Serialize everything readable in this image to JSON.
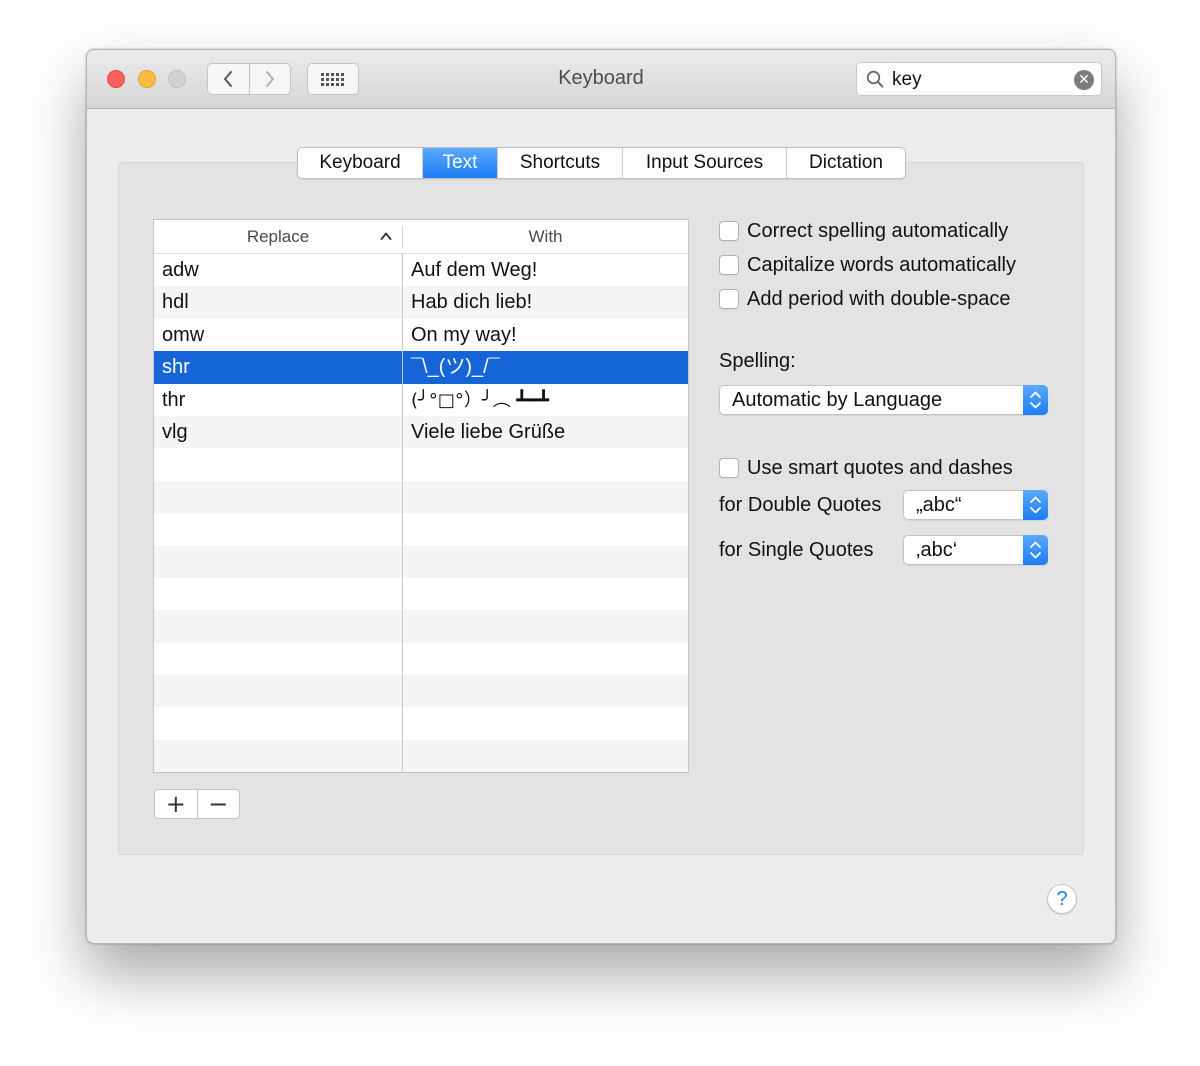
{
  "window": {
    "title": "Keyboard"
  },
  "toolbar": {
    "back_icon": "chevron-left-icon",
    "forward_icon": "chevron-right-icon",
    "show_all_icon": "grid-icon"
  },
  "search": {
    "value": "key",
    "clear_icon": "clear-icon"
  },
  "tabs": [
    {
      "label": "Keyboard",
      "selected": false
    },
    {
      "label": "Text",
      "selected": true
    },
    {
      "label": "Shortcuts",
      "selected": false
    },
    {
      "label": "Input Sources",
      "selected": false
    },
    {
      "label": "Dictation",
      "selected": false
    }
  ],
  "table": {
    "columns": {
      "replace": "Replace",
      "with": "With"
    },
    "sort": "ascending",
    "rows": [
      {
        "replace": "adw",
        "with": "Auf dem Weg!",
        "selected": false
      },
      {
        "replace": "hdl",
        "with": "Hab dich lieb!",
        "selected": false
      },
      {
        "replace": "omw",
        "with": "On my way!",
        "selected": false
      },
      {
        "replace": "shr",
        "with": "¯\\_(ツ)_/¯",
        "selected": true
      },
      {
        "replace": "thr",
        "with": "(╯°□°）╯︵ ┻━┻",
        "selected": false
      },
      {
        "replace": "vlg",
        "with": "Viele liebe Grüße",
        "selected": false
      }
    ],
    "add_label": "+",
    "remove_label": "−"
  },
  "options": {
    "correct_spelling": {
      "label": "Correct spelling automatically",
      "checked": false
    },
    "capitalize_words": {
      "label": "Capitalize words automatically",
      "checked": false
    },
    "add_period": {
      "label": "Add period with double-space",
      "checked": false
    },
    "spelling_label": "Spelling:",
    "spelling_value": "Automatic by Language",
    "smart_quotes": {
      "label": "Use smart quotes and dashes",
      "checked": false
    },
    "double_quotes_label": "for Double Quotes",
    "double_quotes_value": "„abc“",
    "single_quotes_label": "for Single Quotes",
    "single_quotes_value": "‚abc‘"
  },
  "help": {
    "label": "?"
  },
  "colors": {
    "accent": "#1d7df5",
    "selection": "#1665d8",
    "close": "#fc605c",
    "minimize": "#fdbc40",
    "zoom_disabled": "#d1d1d1"
  }
}
